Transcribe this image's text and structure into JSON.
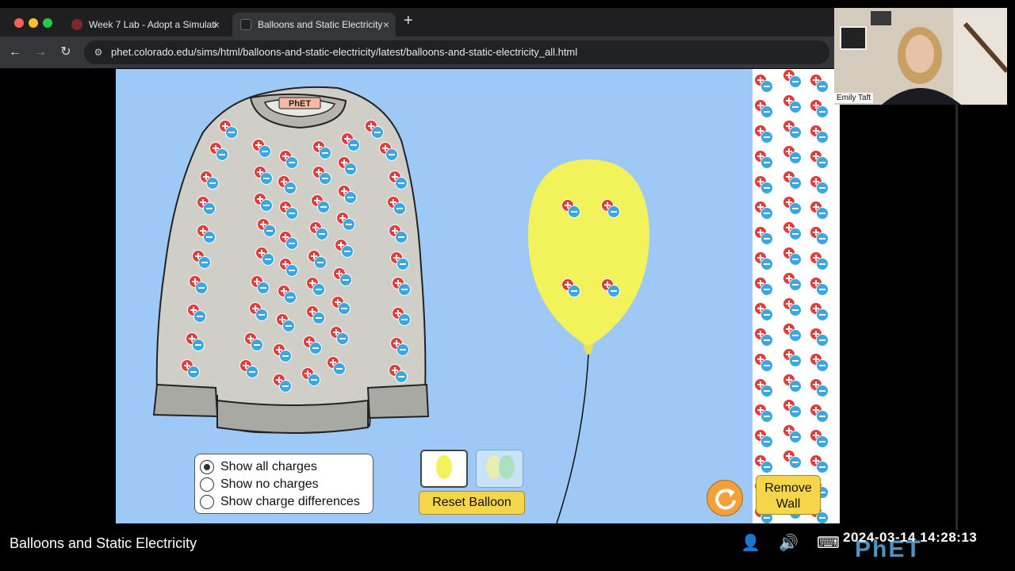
{
  "browser": {
    "tabs": [
      {
        "title": "Week 7 Lab - Adopt a Simulati",
        "active": false
      },
      {
        "title": "Balloons and Static Electricity",
        "active": true
      }
    ],
    "new_tab": "+",
    "url": "phet.colorado.edu/sims/html/balloons-and-static-electricity/latest/balloons-and-static-electricity_all.html"
  },
  "sim": {
    "sweater_label": "PhET",
    "charge_options": [
      {
        "label": "Show all charges",
        "selected": true
      },
      {
        "label": "Show no charges",
        "selected": false
      },
      {
        "label": "Show charge differences",
        "selected": false
      }
    ],
    "reset_balloon_label": "Reset Balloon",
    "remove_wall_line1": "Remove",
    "remove_wall_line2": "Wall",
    "colors": {
      "background": "#9ec8f5",
      "balloon": "#f2f25a",
      "positive": "#e03c3c",
      "negative": "#3aa7e2",
      "button": "#f5d54a"
    }
  },
  "video": {
    "caption": "Balloons and Static Electricity",
    "timestamp": "2024-03-14  14:28:13",
    "webcam_name": "Emily Taft",
    "watermark": "PhET"
  }
}
